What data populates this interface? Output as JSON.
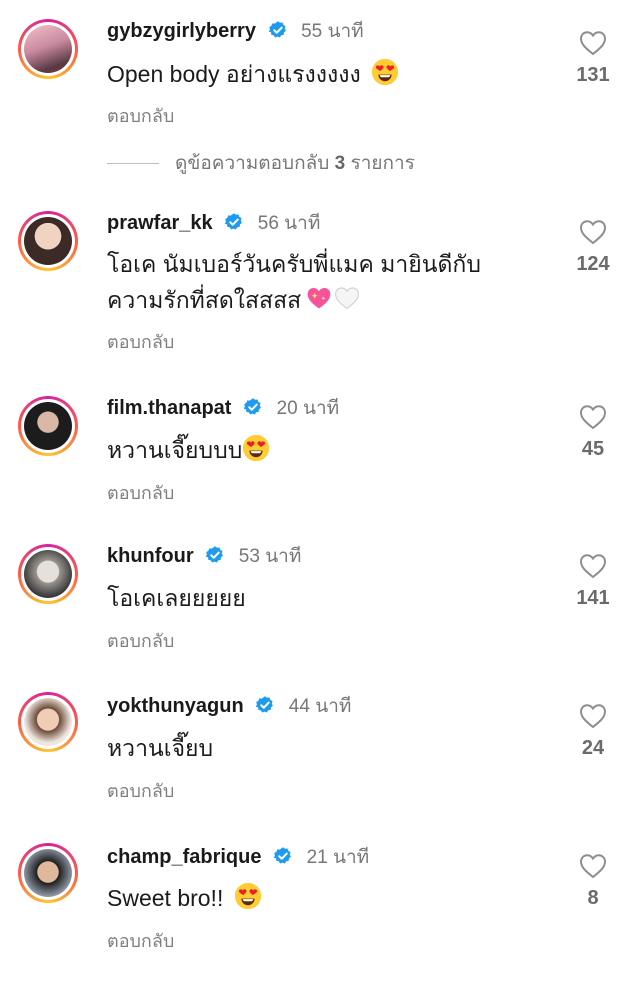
{
  "comments": [
    {
      "username": "gybzygirlyberry",
      "time": "55 นาที",
      "text": "Open body อย่างแรงงงงง",
      "emojis": [
        "heart-eyes"
      ],
      "likes": "131",
      "reply_label": "ตอบกลับ",
      "verified": true
    },
    {
      "username": "prawfar_kk",
      "time": "56 นาที",
      "text_lines": [
        "โอเค นัมเบอร์วันครับพี่แมค มายินดีกับ",
        "ความรักที่สดใสสสส"
      ],
      "emojis": [
        "sparkling-heart",
        "white-heart"
      ],
      "likes": "124",
      "reply_label": "ตอบกลับ",
      "verified": true
    },
    {
      "username": "film.thanapat",
      "time": "20 นาที",
      "text": "หวานเจี๊ยบบบ",
      "emojis": [
        "heart-eyes"
      ],
      "likes": "45",
      "reply_label": "ตอบกลับ",
      "verified": true
    },
    {
      "username": "khunfour",
      "time": "53 นาที",
      "text": "โอเคเลยยยยย",
      "emojis": [],
      "likes": "141",
      "reply_label": "ตอบกลับ",
      "verified": true
    },
    {
      "username": "yokthunyagun",
      "time": "44 นาที",
      "text": "หวานเจี๊ยบ",
      "emojis": [],
      "likes": "24",
      "reply_label": "ตอบกลับ",
      "verified": true
    },
    {
      "username": "champ_fabrique",
      "time": "21 นาที",
      "text": "Sweet bro!!",
      "emojis": [
        "heart-eyes"
      ],
      "likes": "8",
      "reply_label": "ตอบกลับ",
      "verified": true
    }
  ],
  "view_replies": {
    "prefix": "ดูข้อความตอบกลับ",
    "count": "3",
    "suffix": "รายการ"
  },
  "colors": {
    "verified": "#1d9bf0",
    "heart_outline": "#8e8e8e",
    "ring": [
      "#d6249f",
      "#fd5949",
      "#fdc830"
    ]
  },
  "icons": [
    "verified-badge-icon",
    "heart-outline-icon",
    "heart-eyes-emoji",
    "sparkling-heart-emoji",
    "white-heart-emoji"
  ]
}
